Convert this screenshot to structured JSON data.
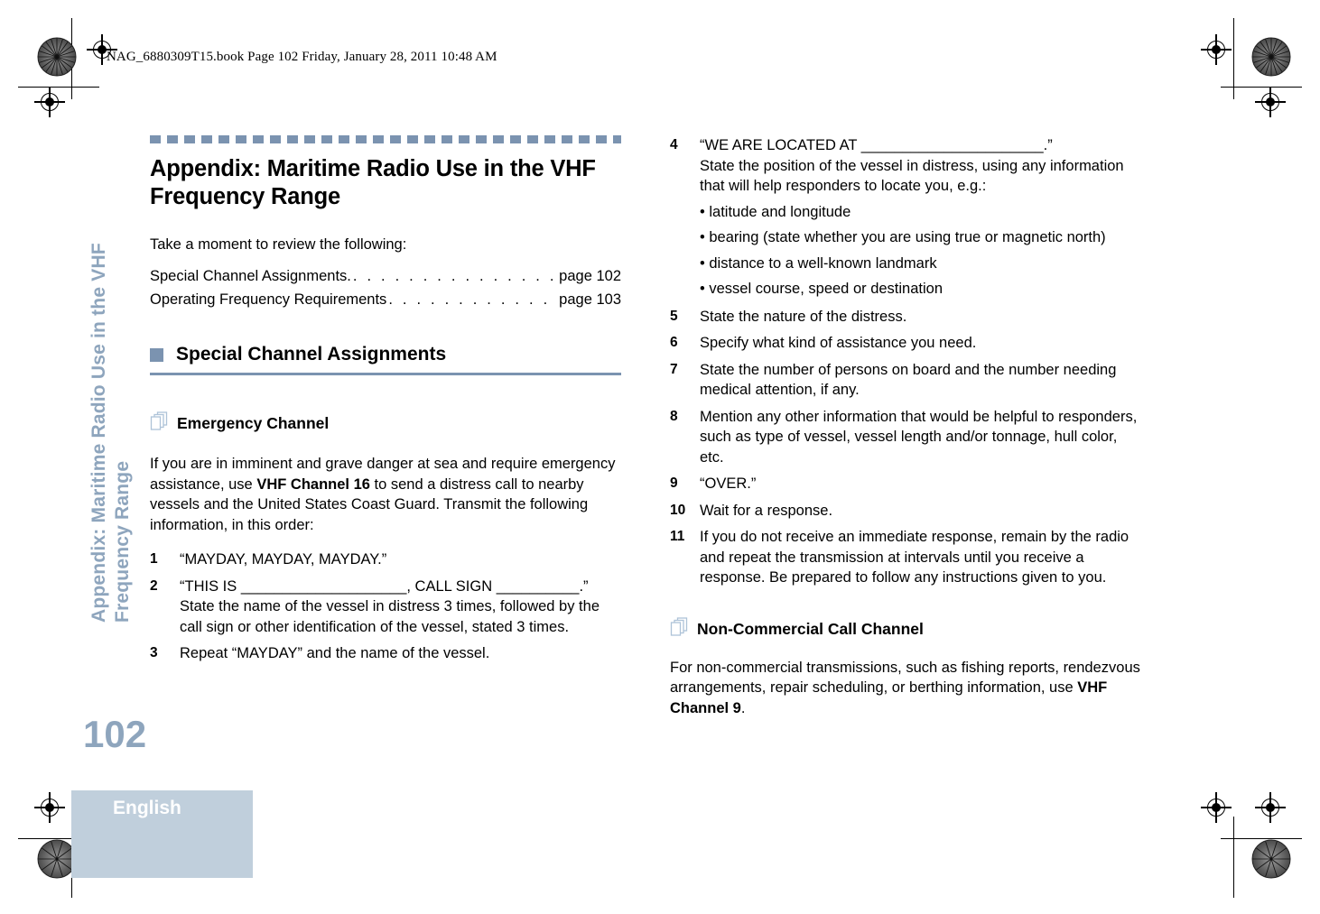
{
  "file_header": "NAG_6880309T15.book  Page 102  Friday, January 28, 2011  10:48 AM",
  "running_head": {
    "line1": "Appendix: Maritime Radio Use in the VHF",
    "line2": "Frequency Range"
  },
  "footer": {
    "page_number": "102",
    "language": "English"
  },
  "colors": {
    "accent_rule": "#7b93b0",
    "running_head": "#8ea5bd",
    "footer_block": "#c0cfdc",
    "icon_outline": "#aec3d8"
  },
  "title": "Appendix: Maritime Radio Use in the VHF Frequency Range",
  "intro": "Take a moment to review the following:",
  "toc": [
    {
      "label": "Special Channel Assignments.",
      "page": "page 102",
      "dots": ". . . . . . . . . . . . . . . . ."
    },
    {
      "label": "Operating Frequency Requirements",
      "page": "page 103",
      "dots": ". . . . . . . . . . . . ."
    }
  ],
  "section": {
    "heading": "Special Channel Assignments"
  },
  "emergency": {
    "heading": "Emergency Channel",
    "intro_a": "If you are in imminent and grave danger at sea and require emergency assistance, use ",
    "intro_bold": "VHF Channel 16",
    "intro_b": " to send a distress call to nearby vessels and the United States Coast Guard. Transmit the following information, in this order:",
    "steps": [
      {
        "num": "1",
        "text": "“MAYDAY, MAYDAY, MAYDAY.”"
      },
      {
        "num": "2",
        "text": "“THIS IS ____________________, CALL SIGN __________.”",
        "note": "State the name of the vessel in distress 3 times, followed by the call sign or other identification of the vessel, stated 3 times."
      },
      {
        "num": "3",
        "text": "Repeat “MAYDAY” and the name of the vessel."
      },
      {
        "num": "4",
        "text": "“WE ARE LOCATED AT ______________________.”",
        "note": "State the position of the vessel in distress, using any information that will help responders to locate you, e.g.:",
        "bullets": [
          "• latitude and longitude",
          "• bearing (state whether you are using true or magnetic north)",
          "• distance to a well-known landmark",
          "• vessel course, speed or destination"
        ]
      },
      {
        "num": "5",
        "text": "State the nature of the distress."
      },
      {
        "num": "6",
        "text": "Specify what kind of assistance you need."
      },
      {
        "num": "7",
        "text": "State the number of persons on board and the number needing medical attention, if any."
      },
      {
        "num": "8",
        "text": "Mention any other information that would be helpful to responders, such as type of vessel, vessel length and/or tonnage, hull color, etc."
      },
      {
        "num": "9",
        "text": "“OVER.”"
      },
      {
        "num": "10",
        "text": "Wait for a response."
      },
      {
        "num": "11",
        "text": "If you do not receive an immediate response, remain by the radio and repeat the transmission at intervals until you receive a response. Be prepared to follow any instructions given to you."
      }
    ]
  },
  "non_commercial": {
    "heading": "Non-Commercial Call Channel",
    "body_a": "For non-commercial transmissions, such as fishing reports, rendezvous arrangements, repair scheduling, or berthing information, use ",
    "body_bold": "VHF Channel 9",
    "body_b": "."
  },
  "icons": {
    "pages": "pages-stack-icon",
    "square_bullet": "square-bullet-icon",
    "registration": "registration-target-icon",
    "rosette": "print-rosette-icon"
  }
}
